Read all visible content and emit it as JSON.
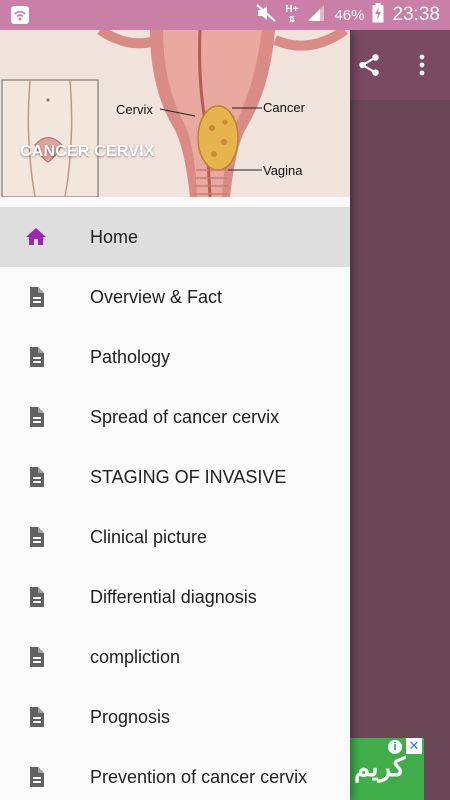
{
  "status_bar": {
    "network": "H+",
    "battery": "46%",
    "time": "23:38"
  },
  "drawer": {
    "title": "CANCER CERVIX",
    "header_image_labels": {
      "cervix": "Cervix",
      "cancer": "Cancer",
      "vagina": "Vagina"
    },
    "items": [
      {
        "label": "Home",
        "icon": "home-icon",
        "active": true
      },
      {
        "label": "Overview & Fact",
        "icon": "document-icon"
      },
      {
        "label": "Pathology",
        "icon": "document-icon"
      },
      {
        "label": "Spread of cancer cervix",
        "icon": "document-icon"
      },
      {
        "label": "STAGING OF INVASIVE",
        "icon": "document-icon"
      },
      {
        "label": "Clinical picture",
        "icon": "document-icon"
      },
      {
        "label": "Differential diagnosis",
        "icon": "document-icon"
      },
      {
        "label": "compliction",
        "icon": "document-icon"
      },
      {
        "label": "Prognosis",
        "icon": "document-icon"
      },
      {
        "label": "Prevention of cancer cervix",
        "icon": "document-icon"
      }
    ]
  },
  "ad": {
    "text": "كريم"
  },
  "colors": {
    "status_bar": "#c97fa6",
    "accent": "#9c27b0",
    "icon_gray": "#616161",
    "ad_green": "#3fae4a"
  }
}
